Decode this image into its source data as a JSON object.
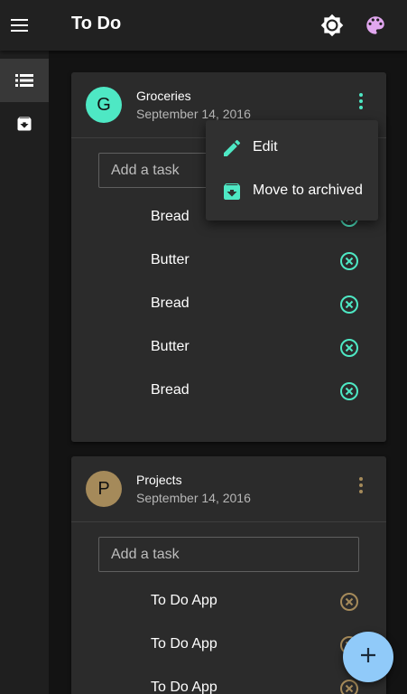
{
  "app": {
    "title": "To Do"
  },
  "icons": {
    "menu": "menu-icon",
    "brightness": "brightness-icon",
    "palette": "palette-icon",
    "list": "list-icon",
    "archive": "archive-icon",
    "more": "more-vert-icon",
    "delete": "cancel-circle-icon",
    "edit": "pencil-icon",
    "add": "plus-icon"
  },
  "colors": {
    "groceries_accent": "#4ee8c4",
    "projects_accent": "#a58a5a",
    "palette_icon": "#e1a7ef",
    "fab": "#90caf9"
  },
  "lists": [
    {
      "avatar": "G",
      "title": "Groceries",
      "date": "September 14, 2016",
      "placeholder": "Add a task",
      "tasks": [
        "Bread",
        "Butter",
        "Bread",
        "Butter",
        "Bread"
      ]
    },
    {
      "avatar": "P",
      "title": "Projects",
      "date": "September 14, 2016",
      "placeholder": "Add a task",
      "tasks": [
        "To Do App",
        "To Do App",
        "To Do App"
      ]
    }
  ],
  "context_menu": {
    "items": [
      {
        "label": "Edit",
        "icon": "pencil-icon"
      },
      {
        "label": "Move to archived",
        "icon": "archive-icon"
      }
    ]
  }
}
